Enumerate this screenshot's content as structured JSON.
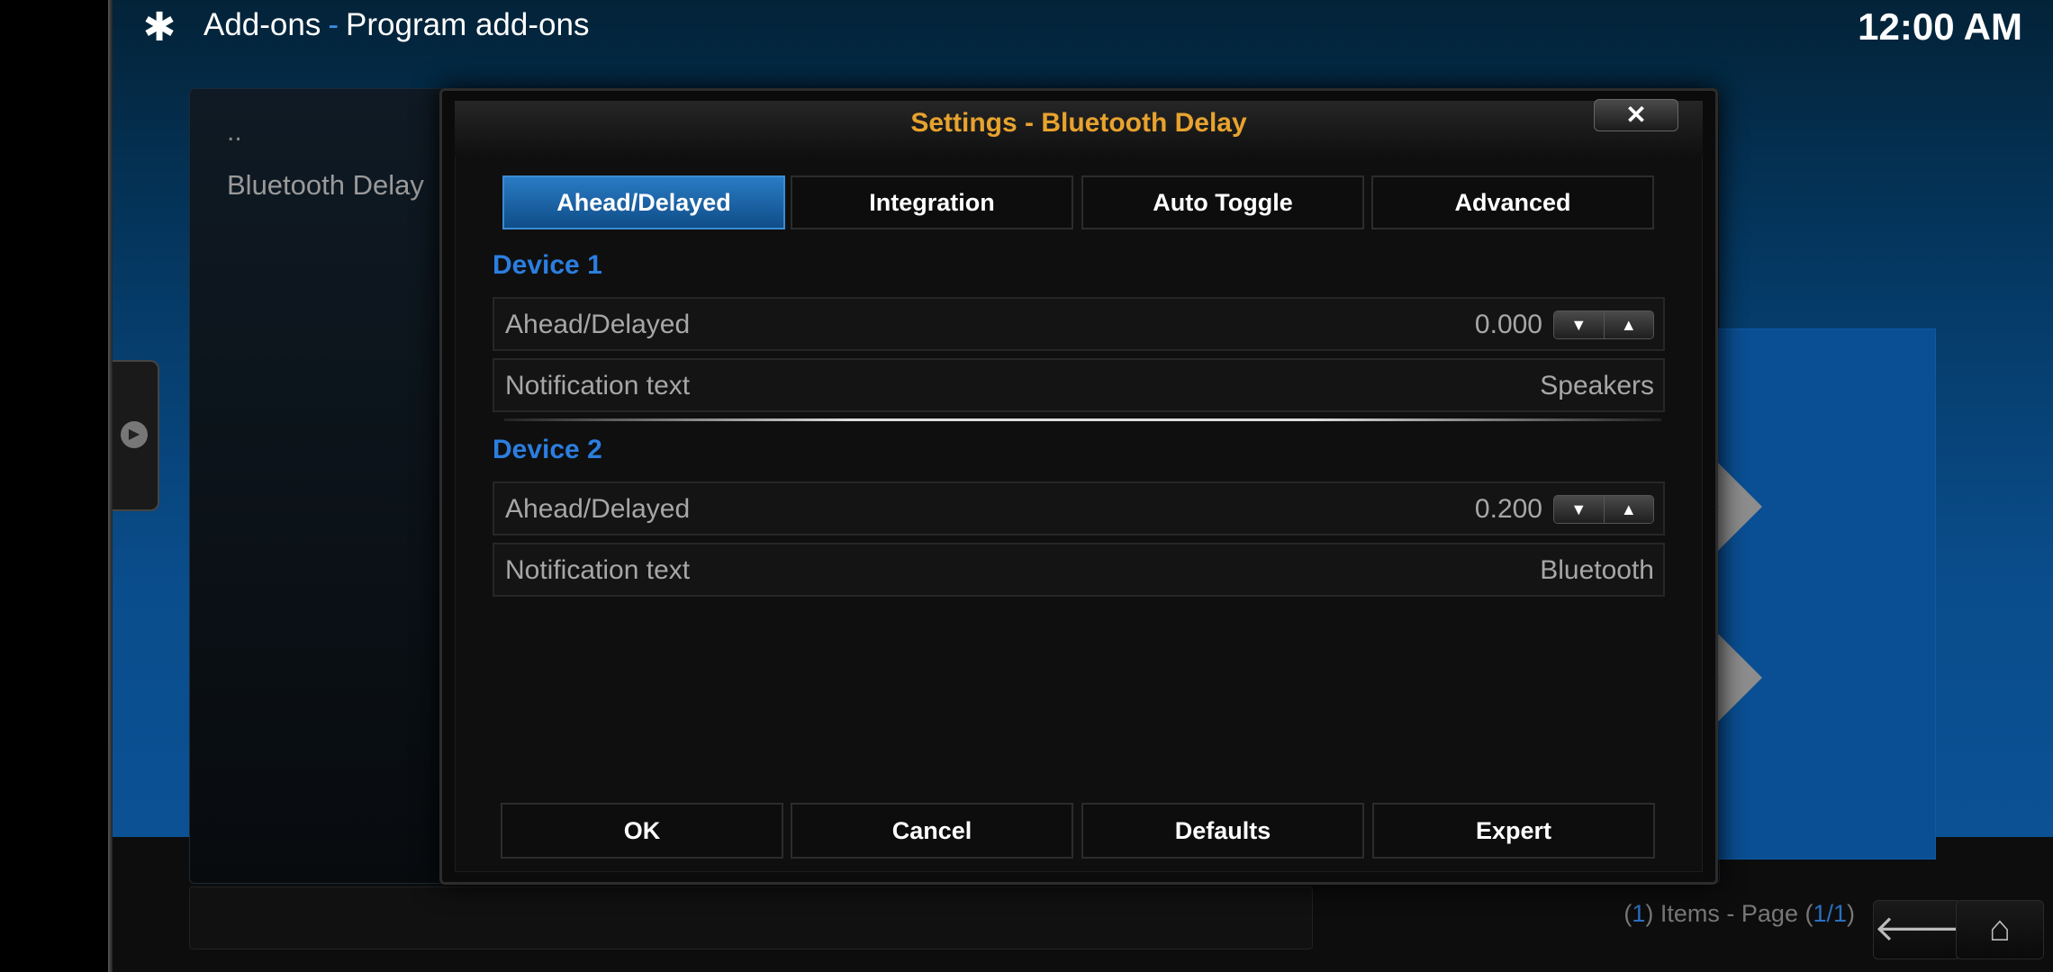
{
  "header": {
    "section": "Add-ons",
    "separator": "-",
    "title": "Program add-ons",
    "clock": "12:00 AM"
  },
  "background_list": {
    "up_item": "..",
    "items": [
      {
        "label": "Bluetooth Delay"
      }
    ]
  },
  "footer": {
    "prefix": "(",
    "count": "1",
    "mid": ") Items - Page (",
    "page": "1/1",
    "suffix": ")"
  },
  "dialog": {
    "title": "Settings - Bluetooth Delay",
    "close_label": "✕",
    "tabs": [
      {
        "label": "Ahead/Delayed",
        "active": true
      },
      {
        "label": "Integration",
        "active": false
      },
      {
        "label": "Auto Toggle",
        "active": false
      },
      {
        "label": "Advanced",
        "active": false
      }
    ],
    "sections": [
      {
        "title": "Device 1",
        "rows": [
          {
            "label": "Ahead/Delayed",
            "value": "0.000"
          },
          {
            "label": "Notification text",
            "value": "Speakers"
          }
        ]
      },
      {
        "title": "Device 2",
        "rows": [
          {
            "label": "Ahead/Delayed",
            "value": "0.200"
          },
          {
            "label": "Notification text",
            "value": "Bluetooth"
          }
        ]
      }
    ],
    "buttons": {
      "ok": "OK",
      "cancel": "Cancel",
      "defaults": "Defaults",
      "expert": "Expert"
    }
  },
  "icons": {
    "header_icon": "puzzle-piece-icon",
    "back": "back-arrow-icon",
    "home": "home-icon"
  },
  "colors": {
    "accent_blue": "#2b7ee0",
    "title_orange": "#e8a32e"
  }
}
